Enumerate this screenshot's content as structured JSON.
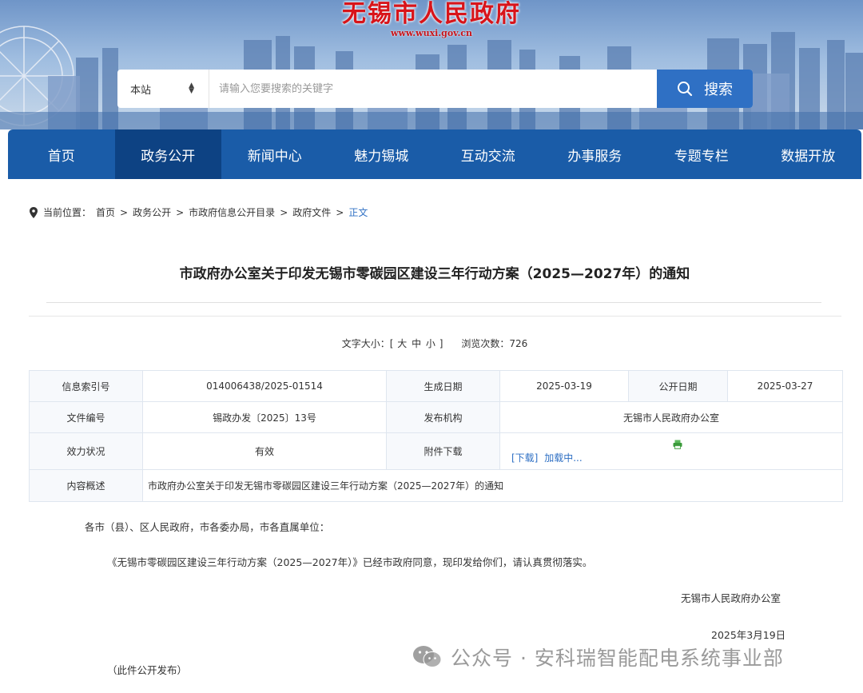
{
  "header": {
    "site_title": "无锡市人民政府",
    "site_url": "www.wuxi.gov.cn"
  },
  "search": {
    "scope": "本站",
    "placeholder": "请输入您要搜索的关键字",
    "button_label": "搜索"
  },
  "nav": {
    "items": [
      {
        "label": "首页"
      },
      {
        "label": "政务公开"
      },
      {
        "label": "新闻中心"
      },
      {
        "label": "魅力锡城"
      },
      {
        "label": "互动交流"
      },
      {
        "label": "办事服务"
      },
      {
        "label": "专题专栏"
      },
      {
        "label": "数据开放"
      }
    ],
    "active_index": 1
  },
  "breadcrumb": {
    "prefix": "当前位置：",
    "items": [
      "首页",
      "政务公开",
      "市政府信息公开目录",
      "政府文件"
    ],
    "separator": ">",
    "current": "正文"
  },
  "article": {
    "title": "市政府办公室关于印发无锡市零碳园区建设三年行动方案（2025—2027年）的通知",
    "font_size_label": "文字大小：[",
    "size_large": "大",
    "size_medium": "中",
    "size_small": "小",
    "font_size_close": "]",
    "views_label": "浏览次数：",
    "views": "726"
  },
  "info_table": {
    "index_label": "信息索引号",
    "index_value": "014006438/2025-01514",
    "created_label": "生成日期",
    "created_value": "2025-03-19",
    "published_label": "公开日期",
    "published_value": "2025-03-27",
    "docno_label": "文件编号",
    "docno_value": "锡政办发〔2025〕13号",
    "issuer_label": "发布机构",
    "issuer_value": "无锡市人民政府办公室",
    "status_label": "效力状况",
    "status_value": "有效",
    "attach_label": "附件下载",
    "attach_link": "[下载]",
    "attach_loading": "加载中...",
    "summary_label": "内容概述",
    "summary_value": "市政府办公室关于印发无锡市零碳园区建设三年行动方案（2025—2027年）的通知"
  },
  "body": {
    "salutation": "各市（县）、区人民政府，市各委办局，市各直属单位：",
    "paragraph": "《无锡市零碳园区建设三年行动方案（2025—2027年）》已经市政府同意，现印发给你们，请认真贯彻落实。",
    "signature": "无锡市人民政府办公室",
    "date": "2025年3月19日",
    "publication_note": "（此件公开发布）"
  },
  "watermark": {
    "text": "公众号 · 安科瑞智能配电系统事业部"
  },
  "colors": {
    "nav_bg": "#1a5ca8",
    "nav_active_bg": "#0d4283",
    "search_button": "#2f70c4",
    "title_red": "#d8141a",
    "link_blue": "#2f70c4"
  }
}
